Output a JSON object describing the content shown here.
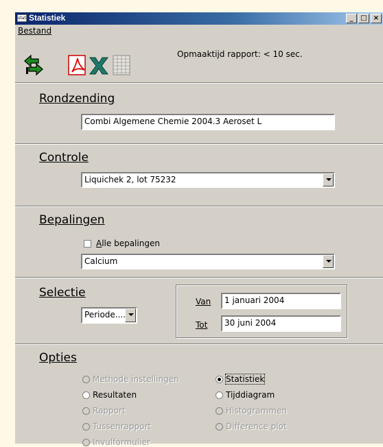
{
  "window": {
    "title": "Statistiek",
    "app_icon_text": "stat",
    "min": "_",
    "max": "□",
    "close": "×"
  },
  "menu": {
    "bestand": "Bestand"
  },
  "toolbar": {
    "icons": [
      "back-arrow-icon",
      "pdf-icon",
      "excel-icon",
      "chart-grid-icon"
    ],
    "opmaaktijd": "Opmaaktijd rapport: < 10 sec."
  },
  "rondzending": {
    "heading": "Rondzending",
    "value": "Combi Algemene Chemie 2004.3 Aeroset L"
  },
  "controle": {
    "heading": "Controle",
    "value": "Liquichek 2, lot 75232"
  },
  "bepalingen": {
    "heading": "Bepalingen",
    "alle_label": "Alle bepalingen",
    "alle_checked": false,
    "value": "Calcium"
  },
  "selectie": {
    "heading": "Selectie",
    "mode": "Periode....",
    "van_label": "Van",
    "van_value": "1 januari 2004",
    "tot_label": "Tot",
    "tot_value": "30 juni 2004"
  },
  "opties": {
    "heading": "Opties",
    "left": [
      {
        "label": "Methode instellingen",
        "enabled": false,
        "selected": false
      },
      {
        "label": "Resultaten",
        "enabled": true,
        "selected": false
      },
      {
        "label": "Rapport",
        "enabled": false,
        "selected": false
      },
      {
        "label": "Tussenrapport",
        "enabled": false,
        "selected": false
      },
      {
        "label": "Invulformulier",
        "enabled": false,
        "selected": false
      }
    ],
    "right": [
      {
        "label": "Statistiek",
        "enabled": true,
        "selected": true
      },
      {
        "label": "Tijddiagram",
        "enabled": true,
        "selected": false
      },
      {
        "label": "Histogrammen",
        "enabled": false,
        "selected": false
      },
      {
        "label": "Difference plot",
        "enabled": false,
        "selected": false
      }
    ]
  }
}
